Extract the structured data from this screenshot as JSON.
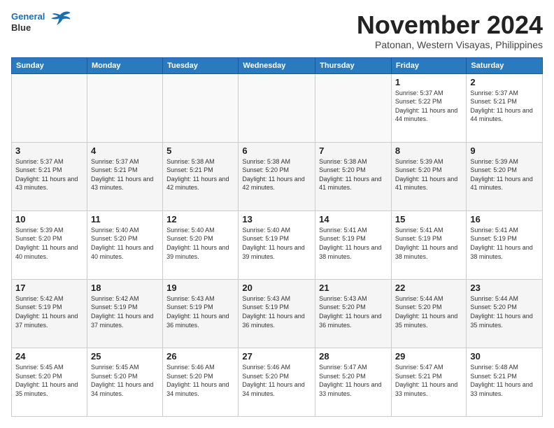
{
  "header": {
    "logo_line1": "General",
    "logo_line2": "Blue",
    "month_title": "November 2024",
    "location": "Patonan, Western Visayas, Philippines"
  },
  "days_of_week": [
    "Sunday",
    "Monday",
    "Tuesday",
    "Wednesday",
    "Thursday",
    "Friday",
    "Saturday"
  ],
  "weeks": [
    [
      {
        "day": "",
        "info": ""
      },
      {
        "day": "",
        "info": ""
      },
      {
        "day": "",
        "info": ""
      },
      {
        "day": "",
        "info": ""
      },
      {
        "day": "",
        "info": ""
      },
      {
        "day": "1",
        "info": "Sunrise: 5:37 AM\nSunset: 5:22 PM\nDaylight: 11 hours and 44 minutes."
      },
      {
        "day": "2",
        "info": "Sunrise: 5:37 AM\nSunset: 5:21 PM\nDaylight: 11 hours and 44 minutes."
      }
    ],
    [
      {
        "day": "3",
        "info": "Sunrise: 5:37 AM\nSunset: 5:21 PM\nDaylight: 11 hours and 43 minutes."
      },
      {
        "day": "4",
        "info": "Sunrise: 5:37 AM\nSunset: 5:21 PM\nDaylight: 11 hours and 43 minutes."
      },
      {
        "day": "5",
        "info": "Sunrise: 5:38 AM\nSunset: 5:21 PM\nDaylight: 11 hours and 42 minutes."
      },
      {
        "day": "6",
        "info": "Sunrise: 5:38 AM\nSunset: 5:20 PM\nDaylight: 11 hours and 42 minutes."
      },
      {
        "day": "7",
        "info": "Sunrise: 5:38 AM\nSunset: 5:20 PM\nDaylight: 11 hours and 41 minutes."
      },
      {
        "day": "8",
        "info": "Sunrise: 5:39 AM\nSunset: 5:20 PM\nDaylight: 11 hours and 41 minutes."
      },
      {
        "day": "9",
        "info": "Sunrise: 5:39 AM\nSunset: 5:20 PM\nDaylight: 11 hours and 41 minutes."
      }
    ],
    [
      {
        "day": "10",
        "info": "Sunrise: 5:39 AM\nSunset: 5:20 PM\nDaylight: 11 hours and 40 minutes."
      },
      {
        "day": "11",
        "info": "Sunrise: 5:40 AM\nSunset: 5:20 PM\nDaylight: 11 hours and 40 minutes."
      },
      {
        "day": "12",
        "info": "Sunrise: 5:40 AM\nSunset: 5:20 PM\nDaylight: 11 hours and 39 minutes."
      },
      {
        "day": "13",
        "info": "Sunrise: 5:40 AM\nSunset: 5:19 PM\nDaylight: 11 hours and 39 minutes."
      },
      {
        "day": "14",
        "info": "Sunrise: 5:41 AM\nSunset: 5:19 PM\nDaylight: 11 hours and 38 minutes."
      },
      {
        "day": "15",
        "info": "Sunrise: 5:41 AM\nSunset: 5:19 PM\nDaylight: 11 hours and 38 minutes."
      },
      {
        "day": "16",
        "info": "Sunrise: 5:41 AM\nSunset: 5:19 PM\nDaylight: 11 hours and 38 minutes."
      }
    ],
    [
      {
        "day": "17",
        "info": "Sunrise: 5:42 AM\nSunset: 5:19 PM\nDaylight: 11 hours and 37 minutes."
      },
      {
        "day": "18",
        "info": "Sunrise: 5:42 AM\nSunset: 5:19 PM\nDaylight: 11 hours and 37 minutes."
      },
      {
        "day": "19",
        "info": "Sunrise: 5:43 AM\nSunset: 5:19 PM\nDaylight: 11 hours and 36 minutes."
      },
      {
        "day": "20",
        "info": "Sunrise: 5:43 AM\nSunset: 5:19 PM\nDaylight: 11 hours and 36 minutes."
      },
      {
        "day": "21",
        "info": "Sunrise: 5:43 AM\nSunset: 5:20 PM\nDaylight: 11 hours and 36 minutes."
      },
      {
        "day": "22",
        "info": "Sunrise: 5:44 AM\nSunset: 5:20 PM\nDaylight: 11 hours and 35 minutes."
      },
      {
        "day": "23",
        "info": "Sunrise: 5:44 AM\nSunset: 5:20 PM\nDaylight: 11 hours and 35 minutes."
      }
    ],
    [
      {
        "day": "24",
        "info": "Sunrise: 5:45 AM\nSunset: 5:20 PM\nDaylight: 11 hours and 35 minutes."
      },
      {
        "day": "25",
        "info": "Sunrise: 5:45 AM\nSunset: 5:20 PM\nDaylight: 11 hours and 34 minutes."
      },
      {
        "day": "26",
        "info": "Sunrise: 5:46 AM\nSunset: 5:20 PM\nDaylight: 11 hours and 34 minutes."
      },
      {
        "day": "27",
        "info": "Sunrise: 5:46 AM\nSunset: 5:20 PM\nDaylight: 11 hours and 34 minutes."
      },
      {
        "day": "28",
        "info": "Sunrise: 5:47 AM\nSunset: 5:20 PM\nDaylight: 11 hours and 33 minutes."
      },
      {
        "day": "29",
        "info": "Sunrise: 5:47 AM\nSunset: 5:21 PM\nDaylight: 11 hours and 33 minutes."
      },
      {
        "day": "30",
        "info": "Sunrise: 5:48 AM\nSunset: 5:21 PM\nDaylight: 11 hours and 33 minutes."
      }
    ]
  ]
}
